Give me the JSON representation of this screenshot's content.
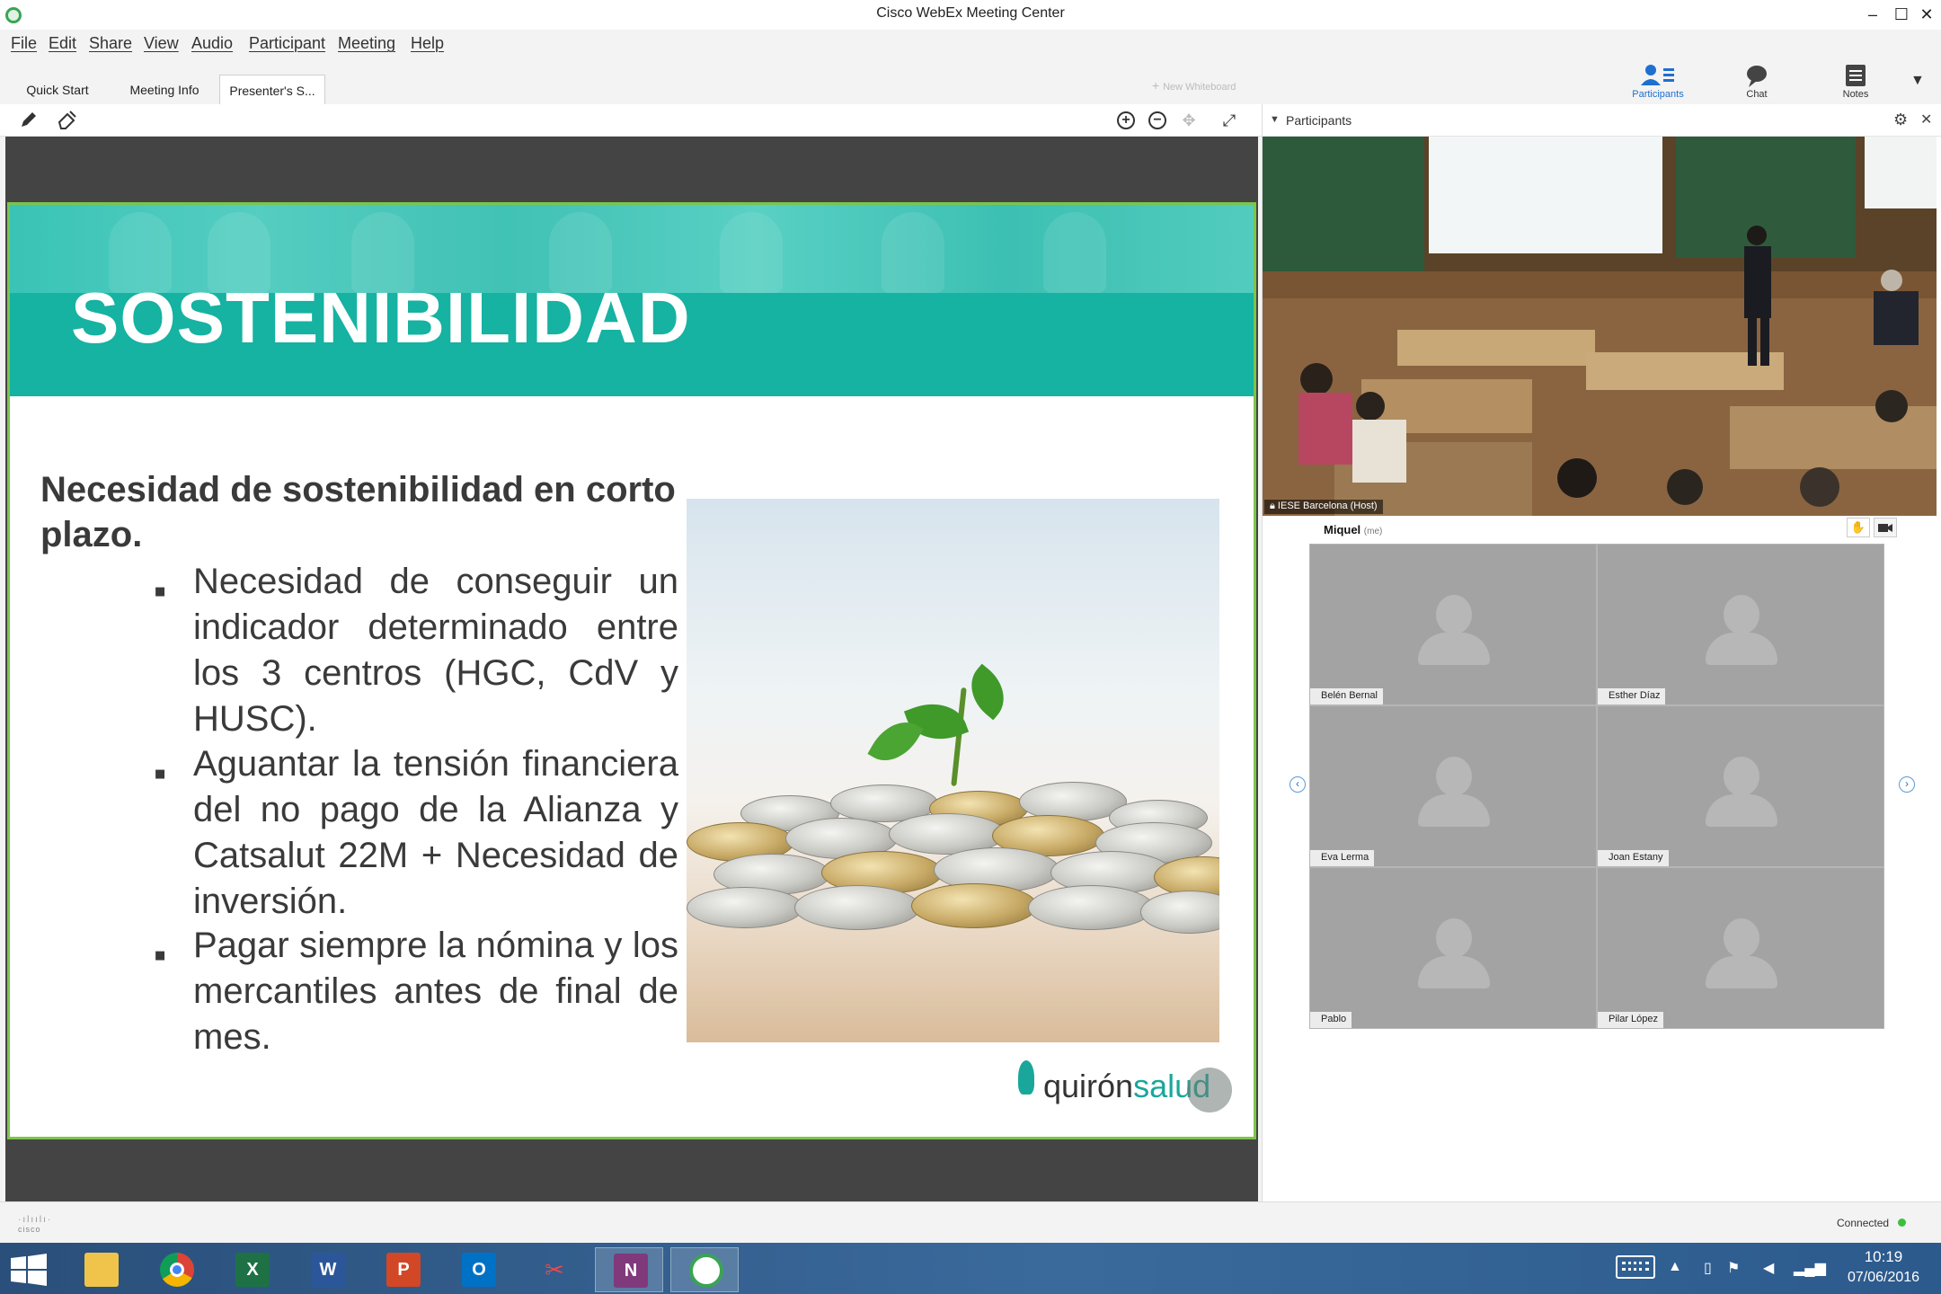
{
  "window": {
    "title": "Cisco WebEx Meeting Center",
    "minimize": "–",
    "maximize": "☐",
    "close": "✕"
  },
  "menu": [
    "File",
    "Edit",
    "Share",
    "View",
    "Audio",
    "Participant",
    "Meeting",
    "Help"
  ],
  "tabs": [
    {
      "label": "Quick Start"
    },
    {
      "label": "Meeting Info"
    },
    {
      "label": "Presenter's S..."
    }
  ],
  "new_whiteboard": "New Whiteboard",
  "panel_buttons": [
    {
      "label": "Participants",
      "icon": "participants-icon"
    },
    {
      "label": "Chat",
      "icon": "chat-icon"
    },
    {
      "label": "Notes",
      "icon": "notes-icon"
    }
  ],
  "slide": {
    "title": "SOSTENIBILIDAD",
    "heading": "Necesidad de sostenibilidad en corto plazo.",
    "bullets": [
      "Necesidad de conseguir un indicador determinado entre los 3 centros (HGC, CdV y HUSC).",
      "Aguantar la tensión financiera del no pago de la Alianza y Catsalut 22M + Necesidad de inversión.",
      "Pagar siempre la nómina y los mercantiles antes de final de mes."
    ],
    "bullet_mark": "▪",
    "logo_part1": "quirón",
    "logo_part2": "salud"
  },
  "participants_panel": {
    "title": "Participants",
    "host_label": "IESE Barcelona (Host)",
    "me_name": "Miquel",
    "me_tag": "(me)",
    "attendees": [
      "Belén Bernal",
      "Esther Díaz",
      "Eva Lerma",
      "Joan Estany",
      "Pablo",
      "Pilar López"
    ]
  },
  "status": {
    "connection": "Connected",
    "brand": "cisco",
    "connected_color": "#3cbf3c"
  },
  "taskbar": {
    "apps": [
      {
        "name": "file-explorer",
        "icon": "folder-icon"
      },
      {
        "name": "chrome",
        "icon": "chrome-icon"
      },
      {
        "name": "excel",
        "icon": "excel-icon",
        "glyph": "X"
      },
      {
        "name": "word",
        "icon": "word-icon",
        "glyph": "W"
      },
      {
        "name": "powerpoint",
        "icon": "powerpoint-icon",
        "glyph": "P"
      },
      {
        "name": "outlook",
        "icon": "outlook-icon",
        "glyph": "O"
      },
      {
        "name": "snipping-tool",
        "icon": "scissors-icon"
      },
      {
        "name": "onenote",
        "icon": "onenote-icon",
        "glyph": "N"
      },
      {
        "name": "webex",
        "icon": "webex-icon"
      }
    ],
    "time": "10:19",
    "date": "07/06/2016"
  },
  "colors": {
    "accent": "#1e6fd0",
    "slide_teal": "#16b2a2",
    "slide_border": "#7cc54a",
    "taskbar": "#2c5a8c"
  }
}
